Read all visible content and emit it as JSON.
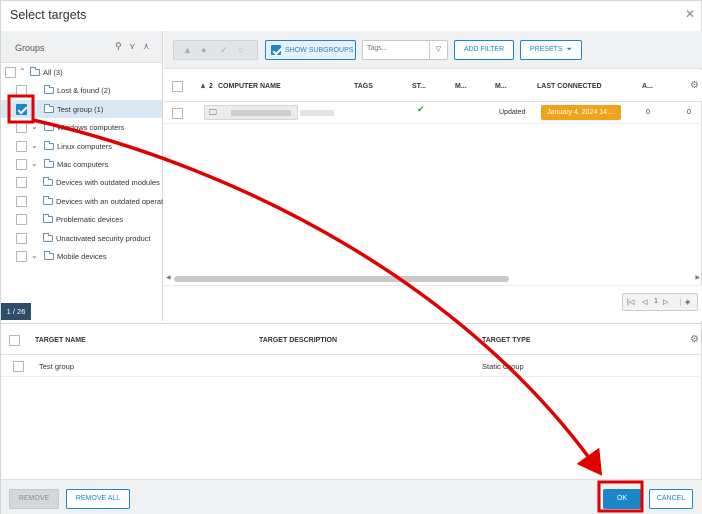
{
  "dialog": {
    "title": "Select targets",
    "close_icon": "✕"
  },
  "groups": {
    "header": "Groups",
    "tree": [
      {
        "label": "All (3)",
        "level": 0,
        "expanded": true,
        "checked": false,
        "selected": false
      },
      {
        "label": "Lost & found (2)",
        "level": 1,
        "expanded": null,
        "checked": false,
        "selected": false
      },
      {
        "label": "Test group (1)",
        "level": 1,
        "expanded": null,
        "checked": true,
        "selected": true
      },
      {
        "label": "Windows computers",
        "level": 1,
        "expanded": false,
        "checked": false,
        "selected": false
      },
      {
        "label": "Linux computers",
        "level": 1,
        "expanded": false,
        "checked": false,
        "selected": false
      },
      {
        "label": "Mac computers",
        "level": 1,
        "expanded": false,
        "checked": false,
        "selected": false
      },
      {
        "label": "Devices with outdated modules",
        "level": 2,
        "expanded": null,
        "checked": false,
        "selected": false
      },
      {
        "label": "Devices with an outdated operat",
        "level": 2,
        "expanded": null,
        "checked": false,
        "selected": false
      },
      {
        "label": "Problematic devices",
        "level": 2,
        "expanded": null,
        "checked": false,
        "selected": false
      },
      {
        "label": "Unactivated security product",
        "level": 2,
        "expanded": null,
        "checked": false,
        "selected": false
      },
      {
        "label": "Mobile devices",
        "level": 1,
        "expanded": false,
        "checked": false,
        "selected": false
      }
    ],
    "page_badge": "1 / 26"
  },
  "toolbar": {
    "show_subgroups": "SHOW SUBGROUPS",
    "tags_placeholder": "Tags...",
    "add_filter": "ADD FILTER",
    "presets": "PRESETS"
  },
  "computers": {
    "columns": [
      "2",
      "COMPUTER NAME",
      "TAGS",
      "ST...",
      "M...",
      "M...",
      "LAST CONNECTED",
      "A..."
    ],
    "rows": [
      {
        "status": "✔",
        "module": "Updated",
        "last_connected": "January 4, 2024 14:...",
        "alerts": "0",
        "last": "0"
      }
    ],
    "pager": {
      "page": "1"
    }
  },
  "targets": {
    "columns": [
      "TARGET NAME",
      "TARGET DESCRIPTION",
      "TARGET TYPE"
    ],
    "rows": [
      {
        "name": "Test group",
        "description": "",
        "type": "Static Group"
      }
    ]
  },
  "footer": {
    "remove": "REMOVE",
    "remove_all": "REMOVE ALL",
    "ok": "OK",
    "cancel": "CANCEL"
  },
  "colors": {
    "accent": "#1a87c9",
    "annotation": "#e00000",
    "warning": "#f0a31a",
    "dark": "#2f4d69"
  }
}
